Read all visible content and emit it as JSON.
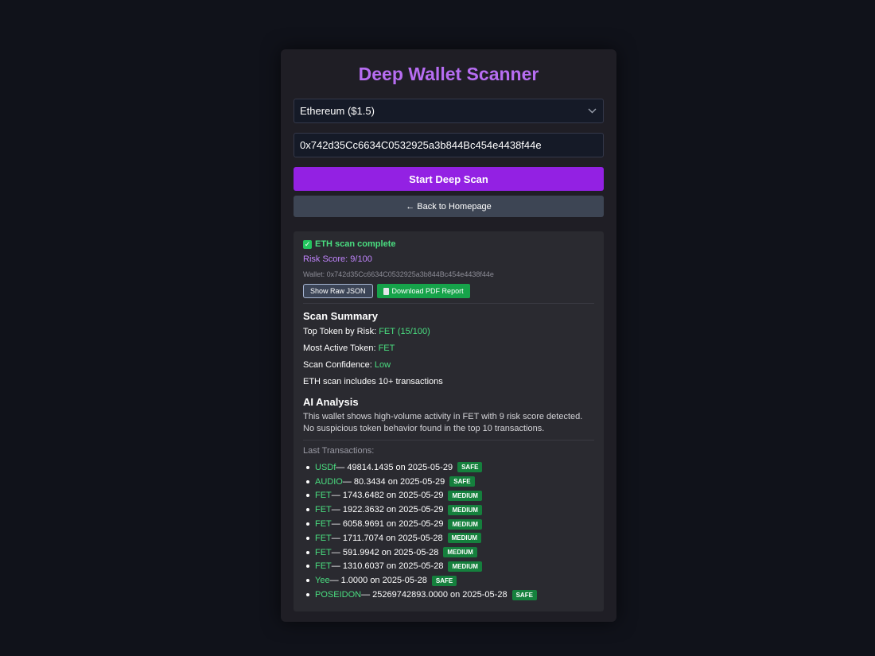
{
  "app": {
    "title": "Deep Wallet Scanner",
    "accent_color": "#b76df2"
  },
  "form": {
    "chain_select": "Ethereum ($1.5)",
    "wallet_input": "0x742d35Cc6634C0532925a3b844Bc454e4438f44e",
    "start_button": "Start Deep Scan",
    "back_button": "← Back to Homepage"
  },
  "result": {
    "status": "ETH scan complete",
    "risk_score": "Risk Score: 9/100",
    "wallet_line": "Wallet: 0x742d35Cc6634C0532925a3b844Bc454e4438f44e",
    "raw_json_button": "Show Raw JSON",
    "pdf_button": "Download PDF Report"
  },
  "summary": {
    "heading": "Scan Summary",
    "top_token_label": "Top Token by Risk: ",
    "top_token_value": "FET (15/100)",
    "most_active_label": "Most Active Token: ",
    "most_active_value": "FET",
    "confidence_label": "Scan Confidence: ",
    "confidence_value": "Low",
    "tx_count_note": "ETH scan includes 10+ transactions"
  },
  "analysis": {
    "heading": "AI Analysis",
    "text": "This wallet shows high-volume activity in FET with 9 risk score detected. No suspicious token behavior found in the top 10 transactions."
  },
  "transactions": {
    "label": "Last Transactions:",
    "items": [
      {
        "token": "USDf",
        "detail": " — 49814.1435 on 2025-05-29",
        "badge": "SAFE"
      },
      {
        "token": "AUDIO",
        "detail": " — 80.3434 on 2025-05-29",
        "badge": "SAFE"
      },
      {
        "token": "FET",
        "detail": " — 1743.6482 on 2025-05-29",
        "badge": "MEDIUM"
      },
      {
        "token": "FET",
        "detail": " — 1922.3632 on 2025-05-29",
        "badge": "MEDIUM"
      },
      {
        "token": "FET",
        "detail": " — 6058.9691 on 2025-05-29",
        "badge": "MEDIUM"
      },
      {
        "token": "FET",
        "detail": " — 1711.7074 on 2025-05-28",
        "badge": "MEDIUM"
      },
      {
        "token": "FET",
        "detail": " — 591.9942 on 2025-05-28",
        "badge": "MEDIUM"
      },
      {
        "token": "FET",
        "detail": " — 1310.6037 on 2025-05-28",
        "badge": "MEDIUM"
      },
      {
        "token": "Yee",
        "detail": " — 1.0000 on 2025-05-28",
        "badge": "SAFE"
      },
      {
        "token": "POSEIDON",
        "detail": " — 25269742893.0000 on 2025-05-28",
        "badge": "SAFE"
      }
    ]
  }
}
